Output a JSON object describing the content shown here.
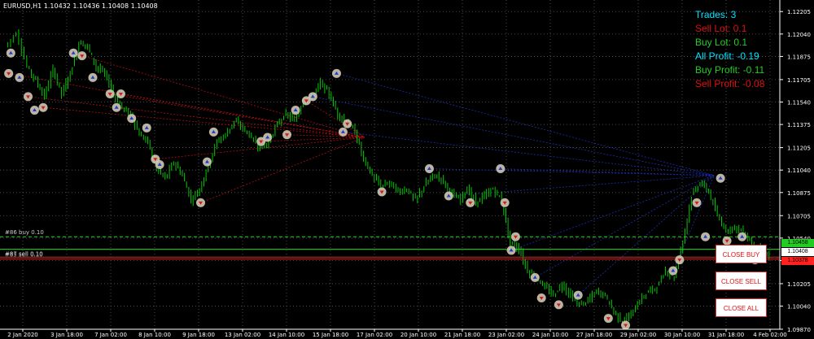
{
  "symbol_label": "EURUSD,H1  1.10432 1.10436 1.10408 1.10408",
  "info_panel": {
    "trades": "Trades: 3",
    "sell_lot": "Sell Lot: 0.1",
    "buy_lot": "Buy Lot: 0.1",
    "all_profit": "All Profit: -0.19",
    "buy_profit": "Buy Profit: -0.11",
    "sell_profit": "Sell Profit: -0.08"
  },
  "colors": {
    "background": "#000000",
    "candle": "#00c800",
    "grid": "#5a5a5a",
    "axis_text": "#ffffff",
    "trades_text": "#00e5ff",
    "sell_text": "#e01010",
    "buy_text": "#22cc22",
    "all_profit_text": "#00e5ff",
    "buy_line": "#22dd22",
    "sell_line": "#dd2222",
    "bid_tag": "#ffffff",
    "ask_tag": "#ff2020",
    "buy_tag": "#22cc22",
    "sell_tag": "#dd2222",
    "sell_link": "#b01010",
    "buy_link": "#1a2fb0",
    "order_marker": "#d2c7b4"
  },
  "buttons": {
    "close_buy": "CLOSE BUY",
    "close_sell": "CLOSE SELL",
    "close_all": "CLOSE ALL"
  },
  "order_labels": {
    "buy": "#86 buy 0.10",
    "sell_a": "#87 sell 0.10",
    "sell_b": "#85 sell 0.10"
  },
  "price_tags": {
    "buy": "1.10458",
    "bid": "1.10408",
    "ask": "1.10378"
  },
  "price_axis": [
    "1.12205",
    "1.12040",
    "1.11875",
    "1.11705",
    "1.11540",
    "1.11375",
    "1.11205",
    "1.11040",
    "1.10875",
    "1.10705",
    "1.10540",
    "1.10375",
    "1.10205",
    "1.10040",
    "1.09870"
  ],
  "time_axis": [
    "2 Jan 2020",
    "3 Jan 18:00",
    "7 Jan 02:00",
    "8 Jan 10:00",
    "9 Jan 18:00",
    "13 Jan 02:00",
    "14 Jan 10:00",
    "15 Jan 18:00",
    "17 Jan 02:00",
    "20 Jan 10:00",
    "21 Jan 18:00",
    "23 Jan 02:00",
    "24 Jan 10:00",
    "27 Jan 18:00",
    "29 Jan 02:00",
    "30 Jan 10:00",
    "31 Jan 18:00",
    "4 Feb 02:00"
  ],
  "chart_data": {
    "type": "candlestick",
    "ylim": [
      1.0987,
      1.1229
    ],
    "y_ticks": [
      1.12205,
      1.1204,
      1.11875,
      1.11705,
      1.1154,
      1.11375,
      1.11205,
      1.1104,
      1.10875,
      1.10705,
      1.1054,
      1.10375,
      1.10205,
      1.1004,
      1.0987
    ],
    "x_tick_labels": [
      "2 Jan 2020",
      "3 Jan 18:00",
      "7 Jan 02:00",
      "8 Jan 10:00",
      "9 Jan 18:00",
      "13 Jan 02:00",
      "14 Jan 10:00",
      "15 Jan 18:00",
      "17 Jan 02:00",
      "20 Jan 10:00",
      "21 Jan 18:00",
      "23 Jan 02:00",
      "24 Jan 10:00",
      "27 Jan 18:00",
      "29 Jan 02:00",
      "30 Jan 10:00",
      "31 Jan 18:00",
      "4 Feb 02:00"
    ],
    "close_path": [
      [
        0,
        1.1195
      ],
      [
        0.5,
        1.1205
      ],
      [
        1,
        1.118
      ],
      [
        1.4,
        1.117
      ],
      [
        1.8,
        1.1158
      ],
      [
        2.2,
        1.1178
      ],
      [
        2.6,
        1.116
      ],
      [
        3.0,
        1.1175
      ],
      [
        3.4,
        1.1198
      ],
      [
        3.8,
        1.1195
      ],
      [
        4.2,
        1.118
      ],
      [
        4.6,
        1.1175
      ],
      [
        5.0,
        1.116
      ],
      [
        5.4,
        1.115
      ],
      [
        5.8,
        1.1145
      ],
      [
        6.2,
        1.113
      ],
      [
        6.6,
        1.1125
      ],
      [
        7.0,
        1.1105
      ],
      [
        7.4,
        1.1098
      ],
      [
        7.8,
        1.111
      ],
      [
        8.2,
        1.11
      ],
      [
        8.6,
        1.1082
      ],
      [
        9.0,
        1.109
      ],
      [
        9.4,
        1.1108
      ],
      [
        9.8,
        1.1125
      ],
      [
        10.2,
        1.113
      ],
      [
        10.6,
        1.114
      ],
      [
        11.0,
        1.1135
      ],
      [
        11.4,
        1.1128
      ],
      [
        11.8,
        1.112
      ],
      [
        12.2,
        1.1125
      ],
      [
        12.6,
        1.1138
      ],
      [
        13.0,
        1.1145
      ],
      [
        13.4,
        1.114
      ],
      [
        13.8,
        1.1155
      ],
      [
        14.2,
        1.1158
      ],
      [
        14.6,
        1.1168
      ],
      [
        15.0,
        1.116
      ],
      [
        15.4,
        1.1145
      ],
      [
        15.8,
        1.114
      ],
      [
        16.2,
        1.1132
      ],
      [
        16.6,
        1.1112
      ],
      [
        17.0,
        1.11
      ],
      [
        17.4,
        1.1092
      ],
      [
        17.8,
        1.1095
      ],
      [
        18.2,
        1.1088
      ],
      [
        18.6,
        1.109
      ],
      [
        19.0,
        1.1082
      ],
      [
        19.4,
        1.1092
      ],
      [
        19.8,
        1.11
      ],
      [
        20.2,
        1.1098
      ],
      [
        20.6,
        1.1088
      ],
      [
        21.0,
        1.1082
      ],
      [
        21.4,
        1.109
      ],
      [
        21.8,
        1.108
      ],
      [
        22.2,
        1.1085
      ],
      [
        22.6,
        1.109
      ],
      [
        23.0,
        1.1082
      ],
      [
        23.4,
        1.105
      ],
      [
        23.8,
        1.1046
      ],
      [
        24.2,
        1.103
      ],
      [
        24.6,
        1.1025
      ],
      [
        25.0,
        1.1018
      ],
      [
        25.4,
        1.1012
      ],
      [
        25.8,
        1.102
      ],
      [
        26.2,
        1.1012
      ],
      [
        26.6,
        1.1005
      ],
      [
        27.0,
        1.1008
      ],
      [
        27.4,
        1.1015
      ],
      [
        27.8,
        1.1012
      ],
      [
        28.2,
        1.1
      ],
      [
        28.6,
        1.0992
      ],
      [
        29.0,
        1.0998
      ],
      [
        29.4,
        1.1008
      ],
      [
        29.8,
        1.1015
      ],
      [
        30.2,
        1.1018
      ],
      [
        30.6,
        1.103
      ],
      [
        31.0,
        1.1025
      ],
      [
        31.4,
        1.1052
      ],
      [
        31.8,
        1.1085
      ],
      [
        32.2,
        1.1095
      ],
      [
        32.6,
        1.1088
      ],
      [
        33.0,
        1.107
      ],
      [
        33.4,
        1.106
      ],
      [
        33.8,
        1.1062
      ],
      [
        34.2,
        1.1058
      ],
      [
        34.6,
        1.105
      ],
      [
        35.0,
        1.1045
      ],
      [
        35.4,
        1.10408
      ]
    ],
    "order_lines": {
      "buy_entry": 1.10458,
      "sell_entry_a": 1.104,
      "sell_entry_b": 1.10385,
      "buy_tp_dashed": 1.1055
    },
    "buy_markers": [
      [
        0.2,
        1.119
      ],
      [
        0.6,
        1.1172
      ],
      [
        1.3,
        1.1148
      ],
      [
        3.1,
        1.119
      ],
      [
        4.0,
        1.1172
      ],
      [
        5.1,
        1.115
      ],
      [
        5.8,
        1.1142
      ],
      [
        6.5,
        1.1135
      ],
      [
        7.1,
        1.1108
      ],
      [
        9.3,
        1.111
      ],
      [
        9.6,
        1.1132
      ],
      [
        12.1,
        1.1128
      ],
      [
        13.4,
        1.1148
      ],
      [
        14.2,
        1.1158
      ],
      [
        15.3,
        1.1175
      ],
      [
        15.6,
        1.1132
      ],
      [
        19.6,
        1.1105
      ],
      [
        20.5,
        1.1085
      ],
      [
        22.9,
        1.1105
      ],
      [
        23.4,
        1.1045
      ],
      [
        24.5,
        1.1025
      ],
      [
        26.5,
        1.1012
      ],
      [
        30.9,
        1.103
      ],
      [
        32.4,
        1.1055
      ],
      [
        33.1,
        1.1098
      ],
      [
        34.1,
        1.1055
      ]
    ],
    "sell_markers": [
      [
        0.1,
        1.1175
      ],
      [
        1.0,
        1.1158
      ],
      [
        1.7,
        1.115
      ],
      [
        3.5,
        1.1188
      ],
      [
        4.8,
        1.116
      ],
      [
        5.3,
        1.116
      ],
      [
        6.9,
        1.1112
      ],
      [
        9.0,
        1.108
      ],
      [
        11.8,
        1.1125
      ],
      [
        13.0,
        1.113
      ],
      [
        13.9,
        1.1155
      ],
      [
        15.8,
        1.1138
      ],
      [
        17.4,
        1.1088
      ],
      [
        21.5,
        1.108
      ],
      [
        23.1,
        1.108
      ],
      [
        23.6,
        1.1055
      ],
      [
        24.8,
        1.101
      ],
      [
        25.6,
        1.1005
      ],
      [
        27.9,
        1.0995
      ],
      [
        28.7,
        1.099
      ],
      [
        31.2,
        1.1038
      ],
      [
        32.0,
        1.108
      ],
      [
        33.4,
        1.1052
      ],
      [
        34.7,
        1.1038
      ]
    ]
  }
}
